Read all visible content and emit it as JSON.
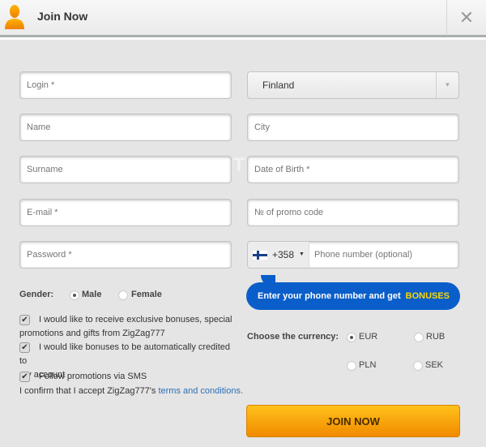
{
  "header": {
    "title": "Join Now",
    "close_icon": "close-icon",
    "avatar_icon": "user-icon",
    "accent": "#f39800"
  },
  "watermark": "SILENTBET",
  "left_fields": [
    {
      "placeholder": "Login *"
    },
    {
      "placeholder": "Name"
    },
    {
      "placeholder": "Surname"
    },
    {
      "placeholder": "E-mail *"
    },
    {
      "placeholder": "Password *"
    }
  ],
  "country": {
    "value": "Finland"
  },
  "right_fields": [
    {
      "placeholder": "City"
    },
    {
      "placeholder": "Date of Birth *"
    },
    {
      "placeholder": "№ of promo code"
    }
  ],
  "phone": {
    "code": "+358",
    "placeholder": "Phone number (optional)"
  },
  "bubble": {
    "text": "Enter your phone number and get",
    "highlight": "BONUSES",
    "color": "#0a5ec9"
  },
  "gender": {
    "label": "Gender:",
    "options": [
      "Male",
      "Female"
    ],
    "selected": "Male"
  },
  "checkboxes": [
    {
      "label_a": "I would like to receive exclusive bonuses, special",
      "label_b": "promotions and gifts from ZigZag777",
      "checked": true
    },
    {
      "label_a": "I would like bonuses to be automatically credited to",
      "label_b": "my account",
      "checked": true
    },
    {
      "label_a": "Follow promotions via SMS",
      "checked": true
    }
  ],
  "terms": {
    "text": "I confirm that I accept ZigZag777's ",
    "link": "terms and conditions."
  },
  "currency": {
    "label": "Choose the currency:",
    "options": [
      "EUR",
      "RUB",
      "PLN",
      "SEK"
    ],
    "selected": "EUR"
  },
  "submit": {
    "label": "JOIN NOW"
  }
}
